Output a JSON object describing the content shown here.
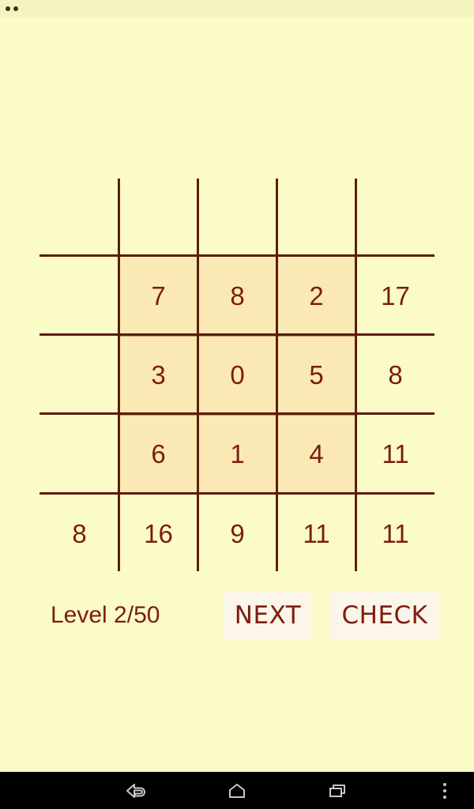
{
  "app": {
    "background_color": "#fbfbc8",
    "ink_color": "#7d1c10",
    "line_color": "#5c1d0d",
    "highlight_color": "#fae9b4",
    "button_color": "#fbf6e9"
  },
  "status_bar": {
    "dots": [
      "status-dot-1",
      "status-dot-2"
    ]
  },
  "puzzle": {
    "grid_values": [
      [
        "7",
        "8",
        "2"
      ],
      [
        "3",
        "0",
        "5"
      ],
      [
        "6",
        "1",
        "4"
      ]
    ],
    "row_sums": [
      "17",
      "8",
      "11"
    ],
    "col_sums": [
      "16",
      "9",
      "11"
    ],
    "diagonal_sums": {
      "anti": "8",
      "main": "11"
    }
  },
  "footer": {
    "level_label": "Level 2/50",
    "next_label": "NEXT",
    "check_label": "CHECK"
  },
  "navbar": {
    "back": "back-icon",
    "home": "home-icon",
    "recents": "recents-icon",
    "menu": "overflow-menu-icon"
  }
}
